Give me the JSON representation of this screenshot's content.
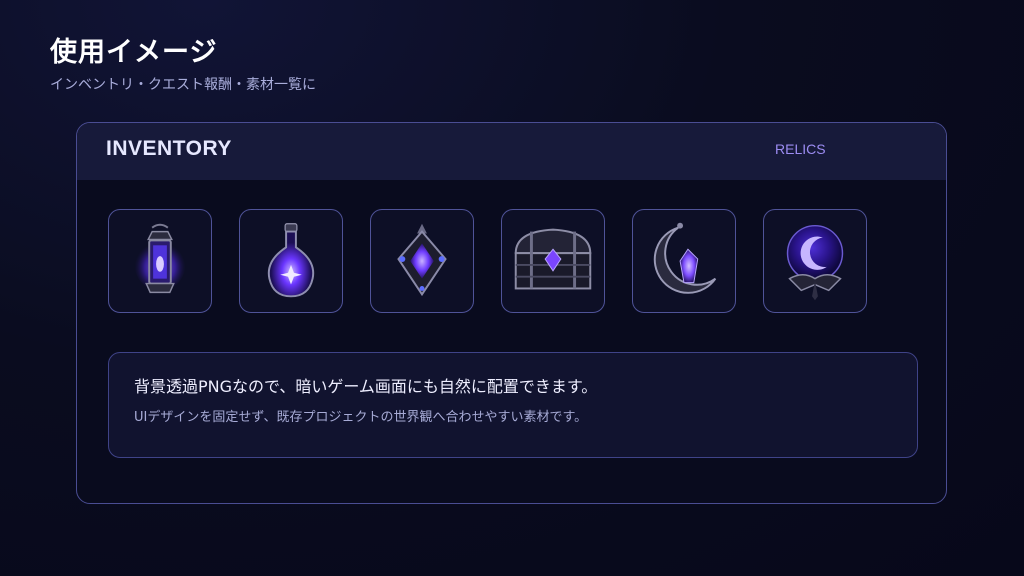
{
  "header": {
    "title": "使用イメージ",
    "subtitle": "インベントリ・クエスト報酬・素材一覧に"
  },
  "panel": {
    "title": "INVENTORY",
    "tab_label": "RELICS"
  },
  "slots": [
    {
      "icon": "lantern-icon"
    },
    {
      "icon": "potion-icon"
    },
    {
      "icon": "amulet-icon"
    },
    {
      "icon": "treasure-chest-icon"
    },
    {
      "icon": "crescent-moon-icon"
    },
    {
      "icon": "crystal-orb-icon"
    }
  ],
  "info": {
    "line1": "背景透過PNGなので、暗いゲーム画面にも自然に配置できます。",
    "line2": "UIデザインを固定せず、既存プロジェクトの世界観へ合わせやすい素材です。"
  },
  "colors": {
    "background": "#0a0c1f",
    "panel_border": "#4a4d93",
    "header_bg": "#171a3a",
    "accent": "#9c8cf2",
    "glow": "#7a4dff"
  }
}
